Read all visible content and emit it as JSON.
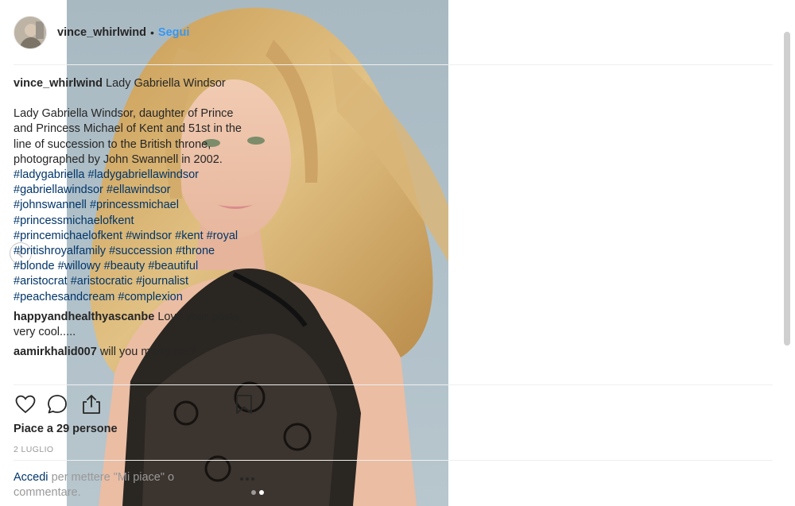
{
  "post": {
    "username": "vince_whirlwind",
    "separator": "•",
    "follow_label": "Segui",
    "caption_title": "Lady Gabriella Windsor",
    "caption_body": "Lady Gabriella Windsor, daughter of Prince and Princess Michael of Kent and 51st in the line of succession to the British throne, photographed by John Swannell in 2002.",
    "hashtags": [
      "#ladygabriella",
      "#ladygabriellawindsor",
      "#gabriellawindsor",
      "#ellawindsor",
      "#johnswannell",
      "#princessmichael",
      "#princessmichaelofkent",
      "#princemichaelofkent",
      "#windsor",
      "#kent",
      "#royal",
      "#britishroyalfamily",
      "#succession",
      "#throne",
      "#blonde",
      "#willowy",
      "#beauty",
      "#beautiful",
      "#aristocrat",
      "#aristocratic",
      "#journalist",
      "#peachesandcream",
      "#complexion"
    ],
    "comments": [
      {
        "user": "happyandhealthyascanbe",
        "text": "Love your posts, very cool....."
      },
      {
        "user": "aamirkhalid007",
        "text": "will you marry me?"
      }
    ],
    "likes_text": "Piace a 29 persone",
    "date": "2 LUGLIO",
    "login_link": "Accedi",
    "login_text": "per mettere \"Mi piace\" o commentare."
  },
  "carousel": {
    "total": 2,
    "current": 2
  },
  "icons": {
    "prev": "chevron-left-icon",
    "like": "heart-icon",
    "comment": "comment-bubble-icon",
    "share": "share-icon",
    "save": "bookmark-icon",
    "more": "more-options-icon"
  },
  "colors": {
    "link_blue": "#3897f0",
    "hashtag": "#003569",
    "muted": "#999999",
    "text": "#262626"
  }
}
